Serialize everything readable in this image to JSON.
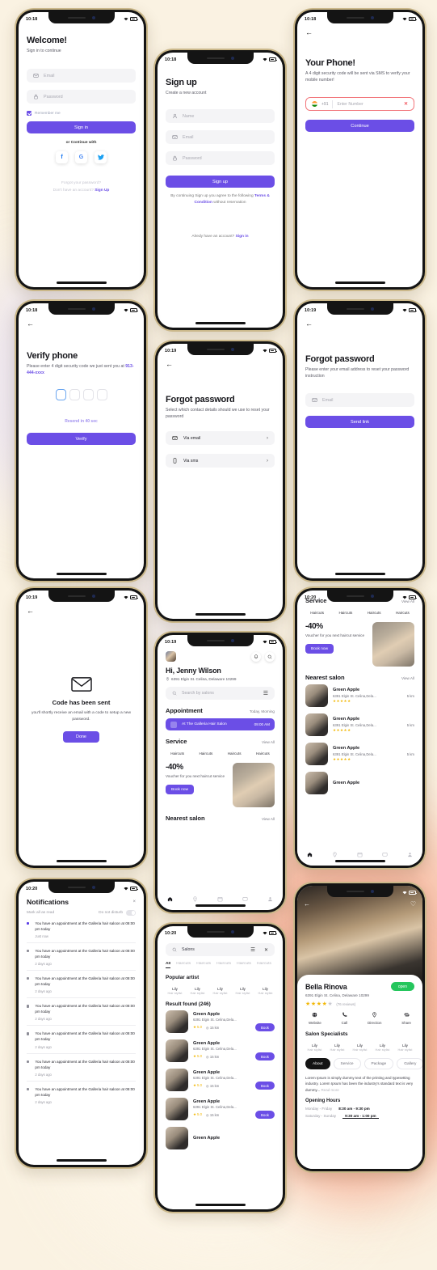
{
  "theme": {
    "accent": "#6b4ee6",
    "background": "#faf2e2",
    "peach": "#f7b9a1",
    "danger": "#f2757a",
    "star": "#f2b705",
    "open_green": "#25c65d",
    "field_bg": "#f4f4f6"
  },
  "screens": {
    "welcome": {
      "status_time": "10:18",
      "title": "Welcome!",
      "subtitle": "Sign in to continue",
      "email_placeholder": "Email",
      "password_placeholder": "Password",
      "remember_label": "Remember me",
      "signin_button": "Sign in",
      "continue_with": "or Continue with",
      "socials": [
        "facebook-icon",
        "google-icon",
        "twitter-icon"
      ],
      "social_glyphs": [
        "f",
        "G",
        "ᵥ"
      ],
      "forgot_link": "Forgot your password?",
      "no_account_text": "Don't have an account?",
      "signup_link": "Sign Up"
    },
    "signup": {
      "status_time": "10:18",
      "title": "Sign up",
      "subtitle": "Create a new account",
      "name_placeholder": "Name",
      "email_placeholder": "Email",
      "password_placeholder": "Password",
      "signup_button": "Sign up",
      "terms_prefix": "By continuing Sign up you agree to the following",
      "terms_link": "Terms & Condition",
      "terms_suffix": "without reservation",
      "have_account_text": "Alredy have an account?",
      "signin_link": "Sign in"
    },
    "your_phone": {
      "status_time": "10:18",
      "title": "Your Phone!",
      "subtitle": "A 4 digit security code will be sent via SMS to verify your mobile number!",
      "country_code": "+91",
      "number_placeholder": "Enter Number",
      "continue_button": "Continue"
    },
    "verify_phone": {
      "status_time": "10:18",
      "title": "Verify phone",
      "subtitle_prefix": "Please enter 4 digit security code we just sent you at",
      "phone_masked": "913-444-xxxx",
      "otp_count": 4,
      "resend_text": "Resend in 40 sec",
      "verify_button": "Verify"
    },
    "forgot_select": {
      "status_time": "10:19",
      "title": "Forgot password",
      "subtitle": "Select which contact details should we use to reset your password",
      "options": [
        {
          "label": "Via email",
          "icon": "mail-icon"
        },
        {
          "label": "Via sms",
          "icon": "phone-icon"
        }
      ]
    },
    "forgot_email": {
      "status_time": "10:19",
      "title": "Forgot password",
      "subtitle": "Please enter your email address to reset your password instruction",
      "email_placeholder": "Email",
      "send_button": "Send link"
    },
    "code_sent": {
      "status_time": "10:19",
      "title": "Code has been sent",
      "subtitle": "you'll shortly receive an email with a code to setup a new password.",
      "done_button": "Done"
    },
    "home": {
      "status_time": "10:19",
      "greeting": "Hi, Jenny Wilson",
      "address": "6391 Elgin St. Celina, Delaware 10299",
      "search_placeholder": "Search by salons",
      "appointment_title": "Appointment",
      "appointment_when": "Today, Morning",
      "appointment_name": "At The Galleria Hair Salon",
      "appointment_time": "09:00 AM",
      "service_title": "Service",
      "view_all": "View All",
      "services": [
        "Haircuts",
        "Haircuts",
        "Haircuts",
        "Haircuts"
      ],
      "promo_percent": "-40%",
      "promo_text": "Voucher for you next haircut service",
      "promo_button": "Book now",
      "nearest_title": "Nearest salon",
      "tabs": [
        "home-icon",
        "location-icon",
        "calendar-icon",
        "chat-icon",
        "profile-icon"
      ],
      "tab_glyphs": [
        "⌂",
        "◎",
        "≡",
        "▭",
        "⚫"
      ]
    },
    "service_list": {
      "status_time": "10:20",
      "service_title": "Service",
      "view_all": "View All",
      "services": [
        "Haircuts",
        "Haircuts",
        "Haircuts",
        "Haircuts"
      ],
      "promo_percent": "-40%",
      "promo_text": "Voucher for you next haircut service",
      "promo_button": "Book now",
      "nearest_title": "Nearest salon",
      "salons": [
        {
          "name": "Green Apple",
          "address": "6391 Elgin St. Celina,Dela...",
          "stars": "★★★★★",
          "distance": "5 km"
        },
        {
          "name": "Green Apple",
          "address": "6391 Elgin St. Celina,Dela...",
          "stars": "★★★★★",
          "distance": "5 km"
        },
        {
          "name": "Green Apple",
          "address": "6391 Elgin St. Celina,Dela...",
          "stars": "★★★★★",
          "distance": "5 km"
        },
        {
          "name": "Green Apple",
          "address": "",
          "stars": "",
          "distance": ""
        }
      ]
    },
    "notifications": {
      "status_time": "10:20",
      "title": "Notifications",
      "close": "×",
      "mark_all": "Mark all as read",
      "dnd_label": "Do not disturb",
      "items": [
        {
          "text": "You have an appointment at the Galleria hair saloon at 08:00 pm today",
          "time": "Just now",
          "unread": true
        },
        {
          "text": "You have an appointment at the Galleria hair saloon at 08:00 pm today",
          "time": "2 days ago",
          "unread": false
        },
        {
          "text": "You have an appointment at the Galleria hair saloon at 08:00 pm today",
          "time": "2 days ago",
          "unread": false
        },
        {
          "text": "You have an appointment at the Galleria hair saloon at 08:00 pm today",
          "time": "2 days ago",
          "unread": false
        },
        {
          "text": "You have an appointment at the Galleria hair saloon at 08:00 pm today",
          "time": "2 days ago",
          "unread": false
        },
        {
          "text": "You have an appointment at the Galleria hair saloon at 08:00 pm today",
          "time": "2 days ago",
          "unread": false
        },
        {
          "text": "You have an appointment at the Galleria hair saloon at 08:00 pm today",
          "time": "2 days ago",
          "unread": false
        }
      ]
    },
    "search": {
      "status_time": "10:20",
      "search_value": "Salons",
      "chips": [
        "All",
        "Haircuts",
        "Haircuts",
        "Haircuts",
        "Haircuts",
        "Haircuts",
        "H"
      ],
      "popular_title": "Popular artist",
      "artists": [
        {
          "name": "Lily",
          "role": "Hair stylist"
        },
        {
          "name": "Lily",
          "role": "Hair stylist"
        },
        {
          "name": "Lily",
          "role": "Hair stylist"
        },
        {
          "name": "Lily",
          "role": "Hair stylist"
        },
        {
          "name": "Lily",
          "role": "Hair stylist"
        }
      ],
      "result_title": "Result found (246)",
      "results": [
        {
          "name": "Green Apple",
          "address": "6391 Elgin St. Celina,Dela...",
          "rating": "5.0",
          "distance": "15 km",
          "book": "Book"
        },
        {
          "name": "Green Apple",
          "address": "6391 Elgin St. Celina,Dela...",
          "rating": "5.0",
          "distance": "15 km",
          "book": "Book"
        },
        {
          "name": "Green Apple",
          "address": "6391 Elgin St. Celina,Dela...",
          "rating": "5.0",
          "distance": "15 km",
          "book": "Book"
        },
        {
          "name": "Green Apple",
          "address": "6391 Elgin St. Celina,Dela...",
          "rating": "5.0",
          "distance": "15 km",
          "book": "Book"
        },
        {
          "name": "Green Apple",
          "address": "",
          "rating": "",
          "distance": "",
          "book": ""
        }
      ]
    },
    "salon_detail": {
      "name": "Bella Rinova",
      "status_pill": "open",
      "address": "6391 Elgin St. Celina, Delaware 10299",
      "stars_on": "★★★★",
      "stars_off": "★",
      "reviews": "(76 reviews)",
      "actions": [
        {
          "label": "Website",
          "icon": "globe-icon"
        },
        {
          "label": "Call",
          "icon": "phone-icon"
        },
        {
          "label": "Direction",
          "icon": "pin-icon"
        },
        {
          "label": "Share",
          "icon": "share-icon"
        }
      ],
      "specialists_title": "Salon Specialists",
      "specialists": [
        {
          "name": "Lily",
          "role": "Hair stylist"
        },
        {
          "name": "Lily",
          "role": "Hair stylist"
        },
        {
          "name": "Lily",
          "role": "Hair stylist"
        },
        {
          "name": "Lily",
          "role": "Hair stylist"
        },
        {
          "name": "Lily",
          "role": "Hair stylist"
        }
      ],
      "tabs": [
        "About",
        "Service",
        "Package",
        "Gallery"
      ],
      "about_text": "Lorem Ipsum is simply dummy text of the printing and typesetting industry. Lorem Ipsum has been the industry's standard text is very dummy...",
      "read_more": "Read more",
      "hours_title": "Opening Hours",
      "hours": [
        {
          "days": "Monday - Friday",
          "time": "8:30 am - 9:30 pm",
          "selected": false
        },
        {
          "days": "Saturday - Sunday",
          "time": "9:30 am - 1:00 pm",
          "selected": true
        }
      ]
    }
  }
}
